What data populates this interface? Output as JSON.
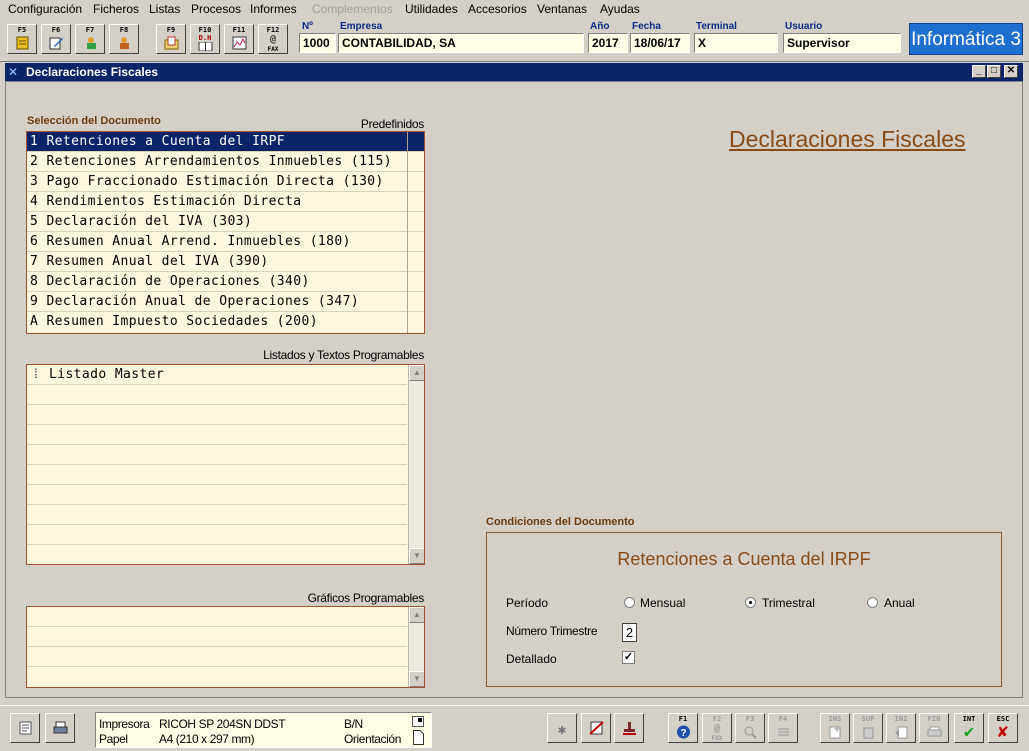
{
  "menu": {
    "items": [
      {
        "label": "Configuración",
        "disabled": false
      },
      {
        "label": "Ficheros",
        "disabled": false
      },
      {
        "label": "Listas",
        "disabled": false
      },
      {
        "label": "Procesos",
        "disabled": false
      },
      {
        "label": "Informes",
        "disabled": false
      },
      {
        "label": "Complementos",
        "disabled": true
      },
      {
        "label": "Utilidades",
        "disabled": false
      },
      {
        "label": "Accesorios",
        "disabled": false
      },
      {
        "label": "Ventanas",
        "disabled": false
      },
      {
        "label": "Ayudas",
        "disabled": false
      }
    ]
  },
  "toolbar": {
    "keys": [
      "F5",
      "F6",
      "F7",
      "F8",
      "F9",
      "F10",
      "F11",
      "F12"
    ],
    "f10_sub": "D.H",
    "f12_sub": "FAX"
  },
  "header": {
    "num_label": "Nº",
    "num_value": "1000",
    "empresa_label": "Empresa",
    "empresa_value": "CONTABILIDAD, SA",
    "anio_label": "Año",
    "anio_value": "2017",
    "fecha_label": "Fecha",
    "fecha_value": "18/06/17",
    "terminal_label": "Terminal",
    "terminal_value": "X",
    "usuario_label": "Usuario",
    "usuario_value": "Supervisor",
    "brand": "Informática 3"
  },
  "window": {
    "title": "Declaraciones Fiscales"
  },
  "seleccion": {
    "label": "Selección del Documento",
    "predefinidos_label": "Predefinidos",
    "items": [
      "1 Retenciones a Cuenta del IRPF",
      "2 Retenciones Arrendamientos Inmuebles (115)",
      "3 Pago Fraccionado Estimación Directa (130)",
      "4 Rendimientos Estimación Directa",
      "5 Declaración del IVA (303)",
      "6 Resumen Anual Arrend. Inmuebles (180)",
      "7 Resumen Anual del IVA (390)",
      "8 Declaración de Operaciones (340)",
      "9 Declaración Anual de Operaciones (347)",
      "A Resumen Impuesto Sociedades (200)"
    ],
    "selected_index": 0
  },
  "listados": {
    "label": "Listados y Textos Programables",
    "items": [
      "Listado Master"
    ]
  },
  "graficos": {
    "label": "Gráficos Programables"
  },
  "main_title": "Declaraciones Fiscales",
  "condiciones": {
    "label": "Condiciones del Documento",
    "title": "Retenciones a Cuenta del IRPF",
    "periodo_label": "Período",
    "periodo_options": [
      "Mensual",
      "Trimestral",
      "Anual"
    ],
    "periodo_selected": "Trimestral",
    "trimestre_label": "Número Trimestre",
    "trimestre_value": "2",
    "detallado_label": "Detallado",
    "detallado_checked": true
  },
  "statusbar": {
    "impresora_label": "Impresora",
    "impresora_value": "RICOH SP 204SN DDST",
    "papel_label": "Papel",
    "papel_value": "A4 (210 x 297 mm)",
    "color_mode": "B/N",
    "orientacion_label": "Orientación",
    "keys": {
      "f1": "F1",
      "f2": "F2",
      "f2_sub": "FAX",
      "f3": "F3",
      "f4": "F4",
      "ins": "INS",
      "sup": "SUP",
      "ini": "INI",
      "fin": "FIN",
      "int": "INT",
      "esc": "ESC"
    }
  }
}
